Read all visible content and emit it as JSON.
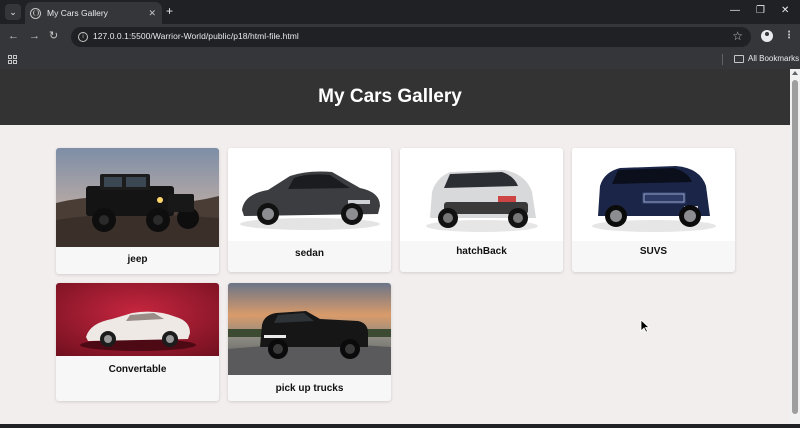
{
  "browser": {
    "tab_title": "My Cars Gallery",
    "url": "127.0.0.1:5500/Warrior-World/public/p18/html-file.html",
    "bookmarks_label": "All Bookmarks",
    "icons": [
      "tab-search-icon",
      "globe-icon",
      "close-icon",
      "plus-icon",
      "minimize-icon",
      "restore-icon",
      "back-arrow-icon",
      "forward-arrow-icon",
      "reload-icon",
      "info-icon",
      "star-icon",
      "profile-icon",
      "kebab-menu-icon",
      "apps-grid-icon",
      "folder-icon"
    ]
  },
  "page": {
    "title": "My Cars Gallery",
    "colors": {
      "header_bg": "#333333",
      "page_bg": "#f3eeee",
      "card_bg": "#f7f7f7"
    },
    "cards": [
      {
        "label": "jeep"
      },
      {
        "label": "sedan"
      },
      {
        "label": "hatchBack"
      },
      {
        "label": "SUVS"
      },
      {
        "label": "Convertable"
      },
      {
        "label": "pick up trucks"
      }
    ]
  }
}
